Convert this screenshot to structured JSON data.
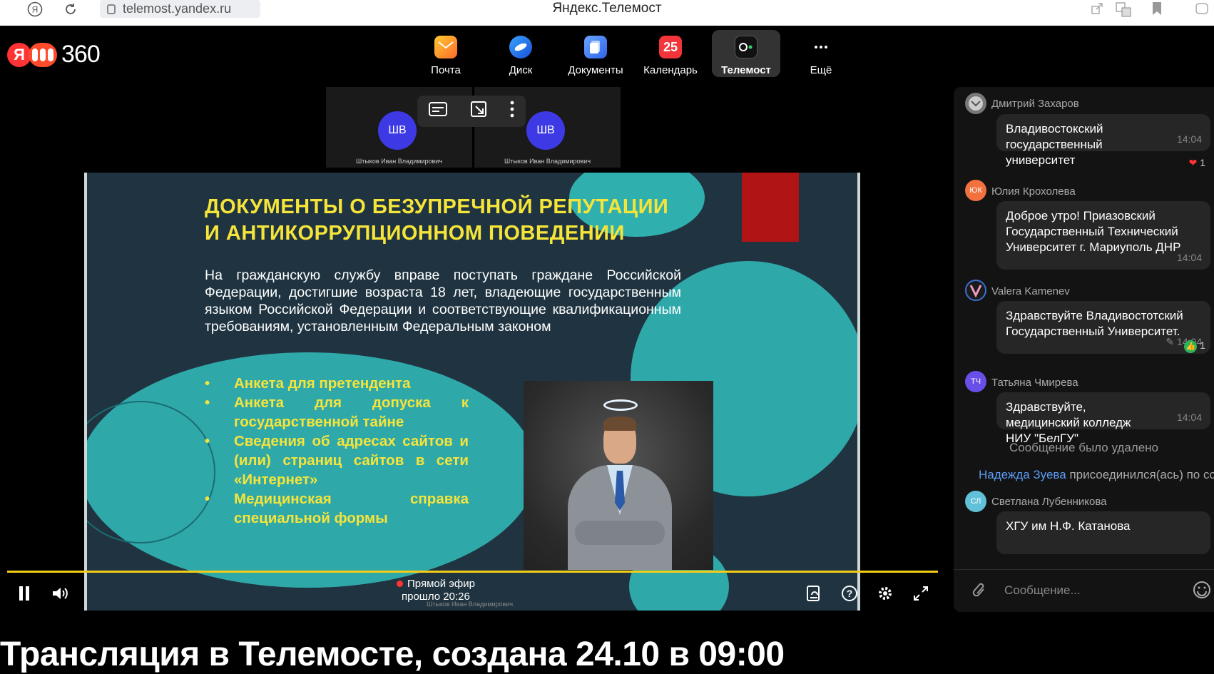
{
  "browser": {
    "url": "telemost.yandex.ru",
    "window_title": "Яндекс.Телемост"
  },
  "header": {
    "logo_text": "360",
    "services": [
      {
        "label": "Почта",
        "icon": "mail-icon",
        "color": "#ff9d1e"
      },
      {
        "label": "Диск",
        "icon": "cloud-disk-icon",
        "color": "#1f6be8"
      },
      {
        "label": "Документы",
        "icon": "documents-icon",
        "color": "#3f7ef7"
      },
      {
        "label": "Календарь",
        "icon": "calendar-icon",
        "color": "#f3343b",
        "badge": "25"
      },
      {
        "label": "Телемост",
        "icon": "telemost-icon",
        "color": "#222",
        "active": true
      },
      {
        "label": "Ещё",
        "icon": "more-dots-icon",
        "color": "#000"
      }
    ]
  },
  "video": {
    "participants": [
      {
        "initials": "ШВ",
        "name": "Штыков Иван Владимирович"
      },
      {
        "initials": "ШВ",
        "name": "Штыков Иван Владимирович"
      }
    ],
    "slide": {
      "title_line1": "ДОКУМЕНТЫ О БЕЗУПРЕЧНОЙ РЕПУТАЦИИ",
      "title_line2": "И АНТИКОРРУПЦИОННОМ ПОВЕДЕНИИ",
      "body": "На гражданскую службу вправе поступать граждане Российской Федерации, достигшие возраста 18 лет, владеющие государственным языком Российской Федерации и соответствующие квалификационным требованиям, установленным Федеральным законом",
      "bullets": [
        "Анкета для претендента",
        "Анкета для допуска к государственной тайне",
        "Сведения об адресах сайтов и (или) страниц сайтов в сети «Интернет»",
        "Медицинская справка специальной формы"
      ]
    },
    "live_label": "Прямой эфир",
    "elapsed": "прошло 20:26",
    "under_name": "Штыков Иван Владимирович"
  },
  "chat": {
    "messages": [
      {
        "author": "Дмитрий Захаров",
        "initials": "",
        "avatar_color": "#888",
        "text": "Владивостокский государственный университет",
        "time": "14:04",
        "reaction": "1"
      },
      {
        "author": "Юлия Крохолева",
        "initials": "ЮК",
        "avatar_color": "#f2713f",
        "text": "Доброе утро! Приазовский Государственный Технический Университет г. Мариуполь ДНР",
        "time": "14:04"
      },
      {
        "author": "Valera Kamenev",
        "initials": "",
        "avatar_color": "#3b6fd6",
        "text": "Здравствуйте Владивостотский Государственный Университет.",
        "time": "14:04",
        "reaction": "1"
      },
      {
        "author": "Татьяна Чмирева",
        "initials": "ТЧ",
        "avatar_color": "#6a4ee8",
        "text": "Здравствуйте, медицинский колледж НИУ \"БелГУ\"",
        "time": "14:04"
      },
      {
        "author": "Светлана Лубенникова",
        "initials": "СЛ",
        "avatar_color": "#61c1d8",
        "text": "ХГУ им Н.Ф. Катанова"
      }
    ],
    "deleted_notice": "Сообщение было удалено",
    "join_name": "Надежда Зуева",
    "join_text": " присоединился(ась) по сс",
    "input_placeholder": "Сообщение..."
  },
  "page_heading": "Трансляция в Телемосте, создана 24.10 в 09:00"
}
